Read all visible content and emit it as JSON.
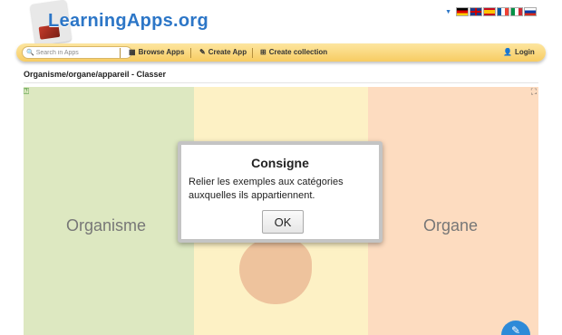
{
  "header": {
    "logo_text": "LearningApps.org",
    "flags": [
      "German",
      "English",
      "Spanish",
      "French",
      "Italian",
      "Russian"
    ]
  },
  "nav": {
    "search_placeholder": "Search in Apps",
    "browse_label": "Browse Apps",
    "create_app_label": "Create App",
    "create_collection_label": "Create collection",
    "login_label": "Login"
  },
  "page": {
    "title": "Organisme/organe/appareil - Classer"
  },
  "app": {
    "categories": [
      {
        "label": "Organisme",
        "color": "#dde8c1"
      },
      {
        "label": "",
        "color": "#fdf1c5"
      },
      {
        "label": "Organe",
        "color": "#fddcc0"
      }
    ]
  },
  "dialog": {
    "title": "Consigne",
    "message": "Relier les exemples aux catégories auxquelles ils appartiennent.",
    "ok_label": "OK"
  },
  "colors": {
    "brand_blue": "#2c76c7",
    "nav_bar": "#f7cc62",
    "fab": "#2e8ad8"
  }
}
